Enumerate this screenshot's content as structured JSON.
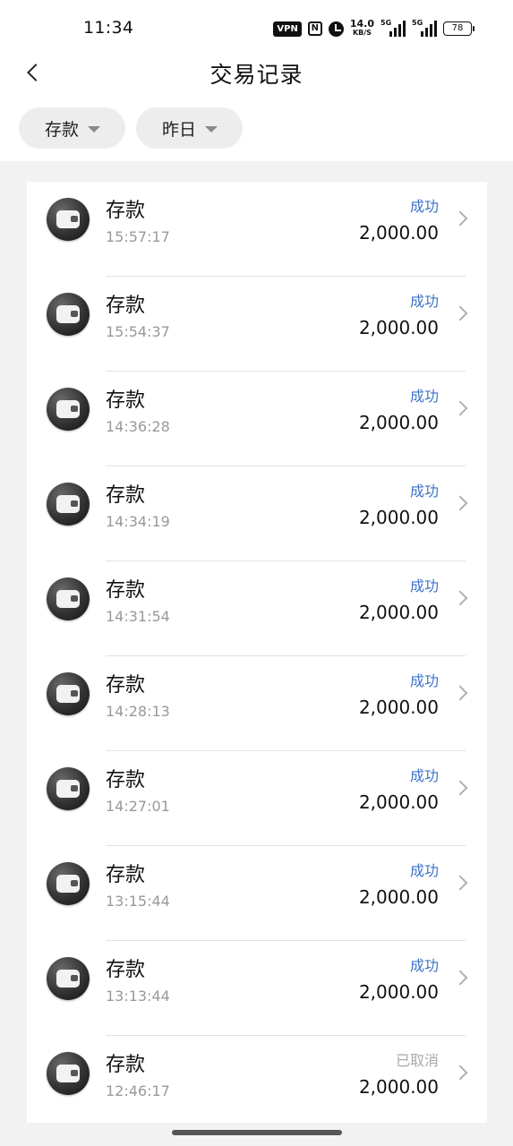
{
  "status": {
    "time": "11:34",
    "vpn": "VPN",
    "nfc": "N",
    "speed_value": "14.0",
    "speed_unit": "KB/S",
    "sim1": "5G",
    "sim2": "5G",
    "battery": "78"
  },
  "header": {
    "title": "交易记录"
  },
  "filters": [
    {
      "label": "存款"
    },
    {
      "label": "昨日"
    }
  ],
  "colors": {
    "success": "#3e73c8",
    "cancelled": "#aaaaaa"
  },
  "transactions": [
    {
      "name": "存款",
      "time": "15:57:17",
      "status": "成功",
      "amount": "2,000.00"
    },
    {
      "name": "存款",
      "time": "15:54:37",
      "status": "成功",
      "amount": "2,000.00"
    },
    {
      "name": "存款",
      "time": "14:36:28",
      "status": "成功",
      "amount": "2,000.00"
    },
    {
      "name": "存款",
      "time": "14:34:19",
      "status": "成功",
      "amount": "2,000.00"
    },
    {
      "name": "存款",
      "time": "14:31:54",
      "status": "成功",
      "amount": "2,000.00"
    },
    {
      "name": "存款",
      "time": "14:28:13",
      "status": "成功",
      "amount": "2,000.00"
    },
    {
      "name": "存款",
      "time": "14:27:01",
      "status": "成功",
      "amount": "2,000.00"
    },
    {
      "name": "存款",
      "time": "13:15:44",
      "status": "成功",
      "amount": "2,000.00"
    },
    {
      "name": "存款",
      "time": "13:13:44",
      "status": "成功",
      "amount": "2,000.00"
    },
    {
      "name": "存款",
      "time": "12:46:17",
      "status": "已取消",
      "amount": "2,000.00"
    }
  ]
}
